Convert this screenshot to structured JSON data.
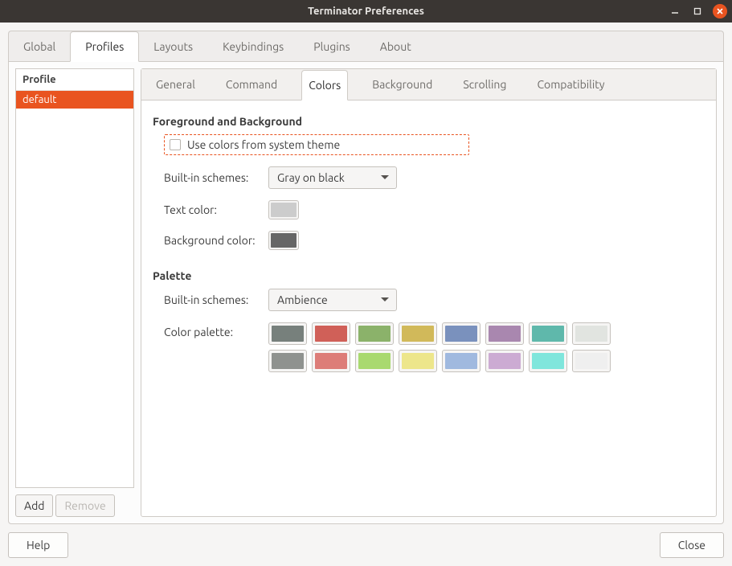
{
  "window": {
    "title": "Terminator Preferences"
  },
  "top_tabs": {
    "items": [
      "Global",
      "Profiles",
      "Layouts",
      "Keybindings",
      "Plugins",
      "About"
    ],
    "active": 1
  },
  "profile_list": {
    "header": "Profile",
    "items": [
      "default"
    ],
    "selected": 0,
    "add_label": "Add",
    "remove_label": "Remove"
  },
  "settings_tabs": {
    "items": [
      "General",
      "Command",
      "Colors",
      "Background",
      "Scrolling",
      "Compatibility"
    ],
    "active": 2
  },
  "colors": {
    "fg_bg_heading": "Foreground and Background",
    "use_system_theme_label": "Use colors from system theme",
    "use_system_theme_checked": false,
    "builtin_label": "Built-in schemes:",
    "fg_bg_scheme": "Gray on black",
    "text_color_label": "Text color:",
    "text_color": "#cccccc",
    "bg_color_label": "Background color:",
    "bg_color": "#666666",
    "palette_heading": "Palette",
    "palette_scheme": "Ambience",
    "color_palette_label": "Color palette:",
    "palette": [
      "#77807c",
      "#d06058",
      "#8bb26a",
      "#d1b95a",
      "#7a91bd",
      "#a987af",
      "#5fb8ab",
      "#e1e4e0",
      "#8f928f",
      "#dd7d78",
      "#a9d96f",
      "#ede68b",
      "#a0b9df",
      "#ccabd3",
      "#80e6dc",
      "#efefef"
    ]
  },
  "bottom": {
    "help": "Help",
    "close": "Close"
  }
}
